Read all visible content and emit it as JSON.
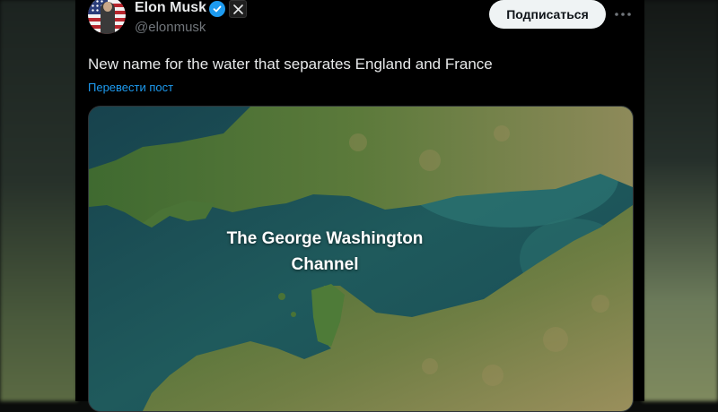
{
  "author": {
    "name": "Elon Musk",
    "handle": "@elonmusk",
    "badges": [
      "verified-icon",
      "x-affiliate-icon"
    ]
  },
  "actions": {
    "follow_label": "Подписаться",
    "more_icon": "more-horizontal-icon"
  },
  "post": {
    "text": "New name for the water that separates England and France",
    "translate_label": "Перевести пост"
  },
  "image": {
    "caption_line1": "The George Washington",
    "caption_line2": "Channel"
  },
  "colors": {
    "accent": "#1d9bf0",
    "background": "#000000",
    "text": "#e7e9ea",
    "muted": "#71767b"
  }
}
